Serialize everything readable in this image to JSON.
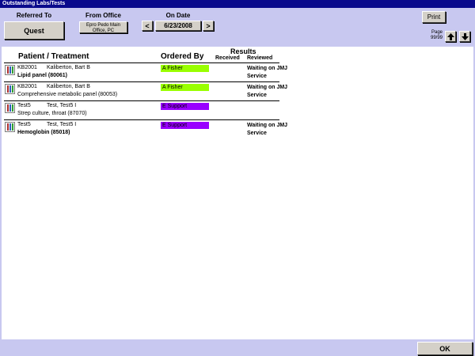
{
  "window": {
    "title": "Outstanding Labs/Tests"
  },
  "header": {
    "referred_to_label": "Referred To",
    "referred_to_value": "Quest",
    "from_office_label": "From Office",
    "from_office_value": "Epro Pedo Main Office, PC",
    "on_date_label": "On Date",
    "date_value": "6/23/2008",
    "prev_label": "<",
    "next_label": ">",
    "print_label": "Print",
    "page_label": "Page",
    "page_value": "99/99"
  },
  "columns": {
    "patient_treatment": "Patient / Treatment",
    "ordered_by": "Ordered By",
    "results": "Results",
    "received": "Received",
    "reviewed": "Reviewed"
  },
  "rows": [
    {
      "id": "KB2001",
      "name": "Kaliberton, Bart B",
      "treatment": "Lipid panel (80061)",
      "treatment_bold": true,
      "ordered_by": "A Fisher",
      "ordered_color": "#99ff00",
      "status": "Waiting on JMJ Service"
    },
    {
      "id": "KB2001",
      "name": "Kaliberton, Bart B",
      "treatment": "Comprehensive metabolic panel (80053)",
      "treatment_bold": false,
      "ordered_by": "A Fisher",
      "ordered_color": "#99ff00",
      "status": "Waiting on JMJ Service"
    },
    {
      "id": "Test5",
      "name": "Test, Test5 I",
      "treatment": "Strep culture, throat (87070)",
      "treatment_bold": false,
      "ordered_by": "E Support",
      "ordered_color": "#9900ff",
      "status": ""
    },
    {
      "id": "Test5",
      "name": "Test, Test5 I",
      "treatment": "Hemoglobin (85018)",
      "treatment_bold": true,
      "ordered_by": "E Support",
      "ordered_color": "#9900ff",
      "status": "Waiting on JMJ Service"
    }
  ],
  "footer": {
    "ok_label": "OK"
  },
  "icons": {
    "lab_icon": "test-tubes-icon",
    "up": "up-arrow-icon",
    "down": "down-arrow-icon"
  }
}
